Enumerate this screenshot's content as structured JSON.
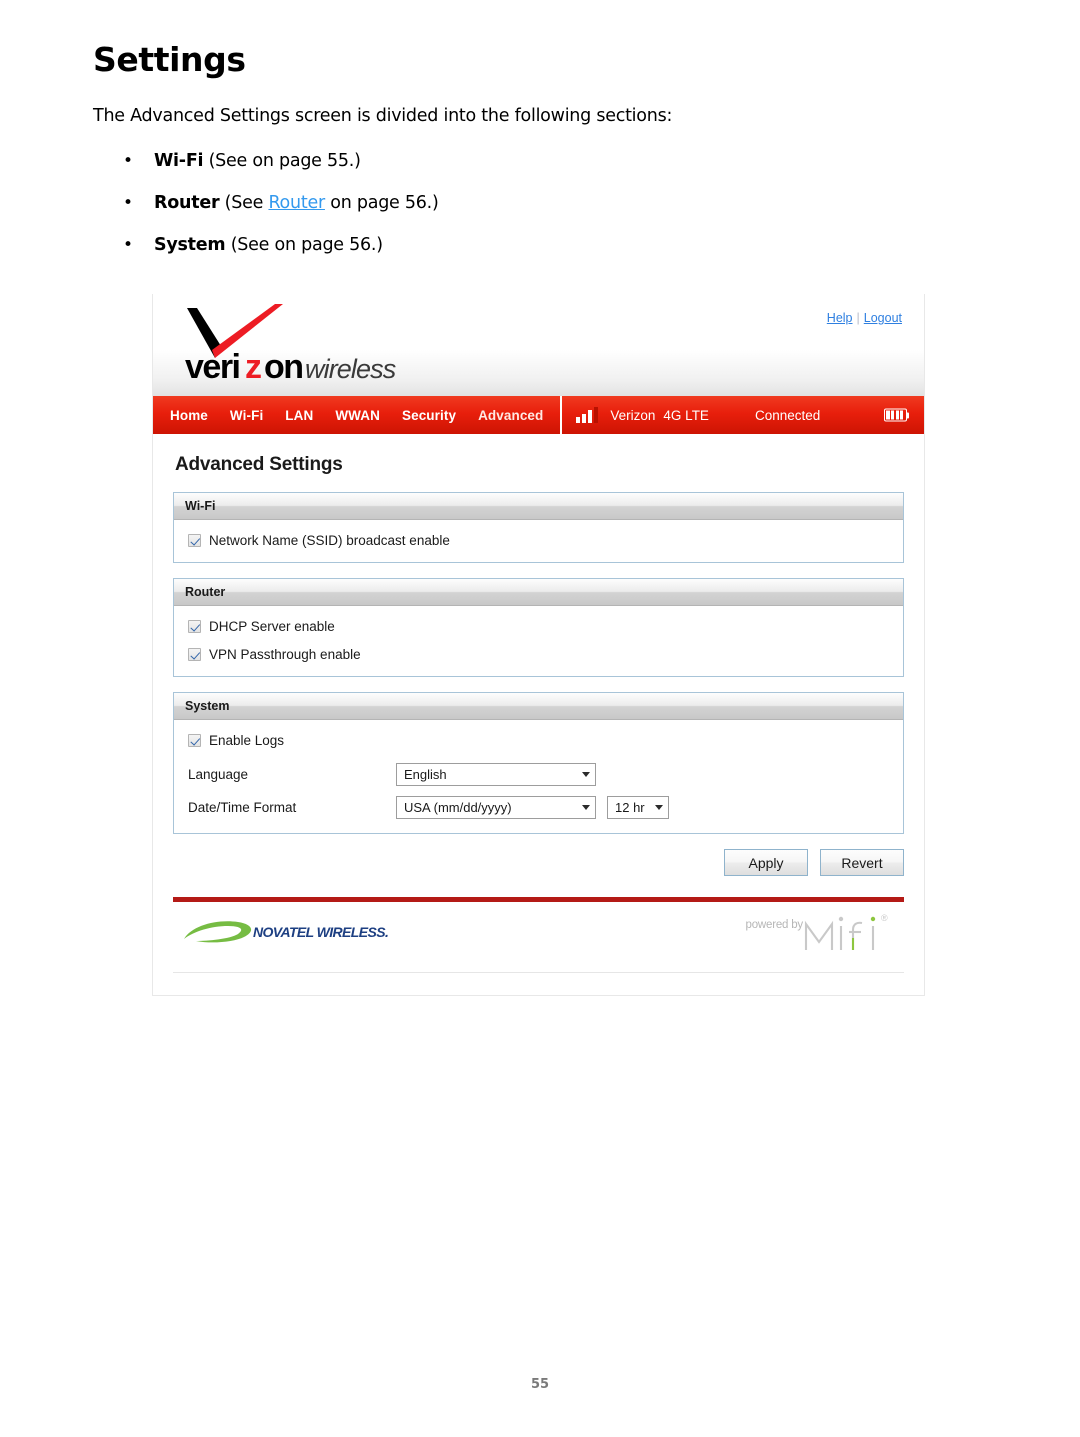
{
  "document": {
    "title": "Settings",
    "intro": "The Advanced Settings screen is divided into the following sections:",
    "bullets": [
      {
        "bullet": "•",
        "term": "Wi-Fi",
        "pre": " (See  on page ",
        "link": "",
        "post": "55.)"
      },
      {
        "bullet": "•",
        "term": "Router",
        "pre": " (See ",
        "link": "Router",
        "post": " on page 56.)"
      },
      {
        "bullet": "•",
        "term": "System",
        "pre": " (See  on page ",
        "link": "",
        "post": "56.)"
      }
    ],
    "page_number": "55"
  },
  "screenshot": {
    "brand": {
      "logo_word_1": "veri",
      "logo_word_2": "z",
      "logo_word_3": "on",
      "logo_word_4": "wireless",
      "help_label": "Help",
      "separator": "|",
      "logout_label": "Logout"
    },
    "nav": {
      "items": [
        {
          "label": "Home",
          "active": false
        },
        {
          "label": "Wi-Fi",
          "active": false
        },
        {
          "label": "LAN",
          "active": false
        },
        {
          "label": "WWAN",
          "active": false
        },
        {
          "label": "Security",
          "active": false
        },
        {
          "label": "Advanced",
          "active": true
        }
      ],
      "carrier": "Verizon",
      "network_type": "4G LTE",
      "connection_state": "Connected",
      "signal_bars": 3,
      "signal_bars_total": 4,
      "battery_segments": 4
    },
    "page_heading": "Advanced Settings",
    "panels": [
      {
        "heading": "Wi-Fi",
        "checkboxes": [
          {
            "label": "Network Name (SSID) broadcast enable",
            "checked": true
          }
        ],
        "fields": []
      },
      {
        "heading": "Router",
        "checkboxes": [
          {
            "label": "DHCP Server enable",
            "checked": true
          },
          {
            "label": "VPN Passthrough enable",
            "checked": true
          }
        ],
        "fields": []
      },
      {
        "heading": "System",
        "checkboxes": [
          {
            "label": "Enable Logs",
            "checked": true
          }
        ],
        "fields": [
          {
            "label": "Language",
            "value": "English",
            "value2": null
          },
          {
            "label": "Date/Time Format",
            "value": "USA (mm/dd/yyyy)",
            "value2": "12 hr"
          }
        ]
      }
    ],
    "buttons": {
      "apply": "Apply",
      "revert": "Revert"
    },
    "footer": {
      "novatel": "NOVATEL WIRELESS.",
      "powered_by": "powered by",
      "mifi": "MiFi",
      "mifi_reg": "®"
    }
  },
  "colors": {
    "verizon_red": "#e81f0c",
    "link_blue": "#2e7fe0",
    "xref_blue": "#3399ee",
    "novatel_blue": "#1d3f82",
    "novatel_green": "#76bc43",
    "footer_rule": "#b41a16",
    "panel_border": "#a8c4d8"
  }
}
